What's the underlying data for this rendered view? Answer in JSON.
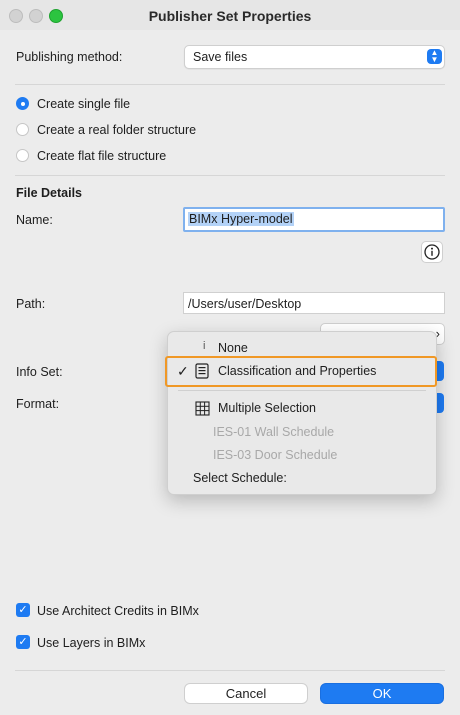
{
  "window": {
    "title": "Publisher Set Properties"
  },
  "publishing": {
    "label": "Publishing method:",
    "value": "Save files"
  },
  "structure_options": [
    {
      "label": "Create single file",
      "selected": true
    },
    {
      "label": "Create a real folder structure",
      "selected": false
    },
    {
      "label": "Create flat file structure",
      "selected": false
    }
  ],
  "file_details": {
    "heading": "File Details",
    "name_label": "Name:",
    "name_value": "BIMx Hyper-model",
    "path_label": "Path:",
    "path_value": "/Users/user/Desktop",
    "info_set_label": "Info Set:",
    "format_label": "Format:"
  },
  "dropdown": {
    "items": [
      {
        "label": "None",
        "icon": "info-glyph-icon",
        "checked": false,
        "enabled": true
      },
      {
        "label": "Classification and Properties",
        "icon": "document-list-icon",
        "checked": true,
        "enabled": true
      },
      {
        "label": "Multiple Selection",
        "icon": "grid-table-icon",
        "checked": false,
        "enabled": true
      },
      {
        "label": "IES-01 Wall Schedule",
        "enabled": false
      },
      {
        "label": "IES-03 Door Schedule",
        "enabled": false
      },
      {
        "label": "Select Schedule:",
        "enabled": true
      }
    ],
    "highlight_color": "#f09826"
  },
  "options": [
    {
      "label": "Use Architect Credits in BIMx",
      "checked": true
    },
    {
      "label": "Use Layers in BIMx",
      "checked": true
    }
  ],
  "buttons": {
    "cancel": "Cancel",
    "ok": "OK"
  },
  "colors": {
    "accent": "#1e7bf2",
    "highlight": "#f09826"
  }
}
